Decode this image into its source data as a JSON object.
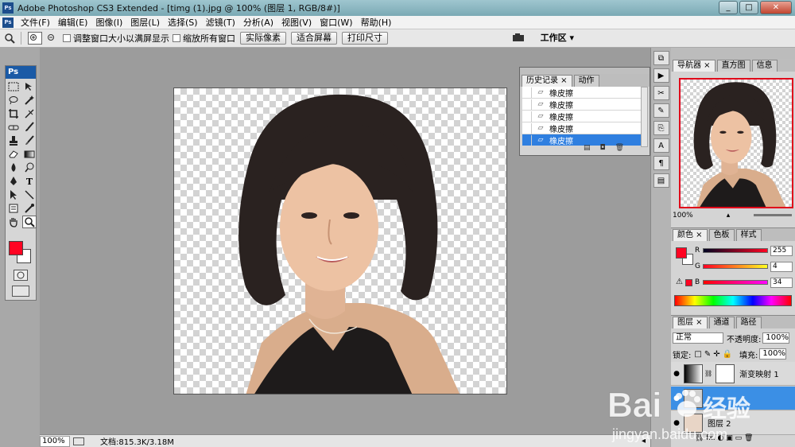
{
  "window": {
    "title": "Adobe Photoshop CS3 Extended - [timg (1).jpg @ 100% (图层 1, RGB/8#)]",
    "app_badge": "Ps",
    "controls": [
      "_",
      "□",
      "✕"
    ]
  },
  "menu": {
    "items": [
      "文件(F)",
      "编辑(E)",
      "图像(I)",
      "图层(L)",
      "选择(S)",
      "滤镜(T)",
      "分析(A)",
      "视图(V)",
      "窗口(W)",
      "帮助(H)"
    ]
  },
  "options": {
    "chk_resize": "调整窗口大小以满屏显示",
    "chk_zoom_all": "缩放所有窗口",
    "btn_actual": "实际像素",
    "btn_fit": "适合屏幕",
    "btn_print": "打印尺寸",
    "workspace": "工作区 ▾"
  },
  "toolbox": {
    "badge": "Ps"
  },
  "status": {
    "zoom": "100%",
    "doc": "文档:815.3K/3.18M"
  },
  "history": {
    "tabs": [
      "历史记录 ×",
      "动作"
    ],
    "items": [
      "橡皮擦",
      "橡皮擦",
      "橡皮擦",
      "橡皮擦",
      "橡皮擦"
    ],
    "selected_index": 4
  },
  "navigator": {
    "tabs": [
      "导航器 ×",
      "直方图",
      "信息"
    ],
    "zoom": "100%"
  },
  "color": {
    "tabs": [
      "颜色 ×",
      "色板",
      "样式"
    ],
    "r": {
      "label": "R",
      "value": "255"
    },
    "g": {
      "label": "G",
      "value": "4"
    },
    "b": {
      "label": "B",
      "value": "34"
    },
    "foreground": "#ff0422"
  },
  "layers": {
    "tabs": [
      "图层 ×",
      "通道",
      "路径"
    ],
    "blend_mode": "正常",
    "opacity_label": "不透明度:",
    "opacity": "100%",
    "lock_label": "锁定:",
    "fill_label": "填充:",
    "fill": "100%",
    "items": [
      {
        "name": "渐变映射 1"
      },
      {
        "name": ""
      },
      {
        "name": "图层 2"
      }
    ],
    "selected_index": 1,
    "footer_icons": "⛓ fx. ◐ ▣ ▭ 🗑"
  },
  "watermark": {
    "brand": "Bai",
    "suffix": "经验",
    "url": "jingyan.baidu.com"
  }
}
